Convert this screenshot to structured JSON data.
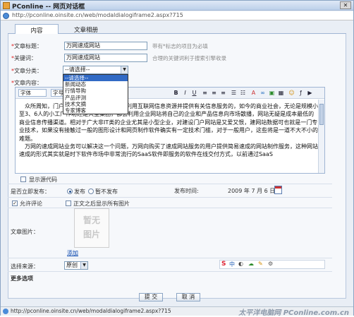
{
  "window": {
    "title": "PConline -- 网页对话框",
    "close": "✕"
  },
  "address": {
    "url": "http://pconline.oinsite.cn/web/modaldialogiframe2.aspx?715"
  },
  "tabs": [
    {
      "label": "内容"
    },
    {
      "label": "文章相册"
    }
  ],
  "form": {
    "title_label": "文章标题：",
    "title_value": "万网速成网站",
    "title_hint": "带有*标志的项目为必填",
    "keyword_label": "关键词：",
    "keyword_value": "万网速成网站",
    "keyword_hint": "合理的关键词利于搜索引擎收录",
    "category_label": "文章分类：",
    "category_value": "--请选择--",
    "content_label": "文章内容："
  },
  "dropdown": {
    "items": [
      "--请选择--",
      "新闻动态",
      "行情导购",
      "产品评测",
      "技术文摘",
      "专家博客"
    ]
  },
  "toolbar": {
    "font_label": "字体",
    "size_label": "字号",
    "bold": "B",
    "italic": "I",
    "underline": "U"
  },
  "content": {
    "p1": "众所周知，门户网站的最大特色是它能够利用互联网信息资源并提供有关信息服务的，如今的商业社会，无论是规模小至3、6人的小工厂作坊还是大型集团，都会利用企业网站将自己的企业和产品信息向市场散播，网站无疑是成本最低的商业信息传播渠道。相对于广大非IT类的企业尤其是小型企业，对建设门户网站是又爱又恨，建网站数据可也就是一门专业技术，如果没有接触过一般的图形设计和网页制作软件确实有一定技术门槛，对于一般用户，这些将是一道不大不小的难题。",
    "p2": "万网的速成网站业务可以解决这一个问题，万网向购买了速成网站服务的用户提供简易速成的网站制作服务，这种网站速成的形式其实就是时下软件市场中非常流行的SaaS软件即服务的软件在线交付方式，以前通过SaaS"
  },
  "source_mode": {
    "label": "显示源代码"
  },
  "publish": {
    "label": "是否立即发布：",
    "opt_yes": "发布",
    "opt_no": "暂不发布",
    "time_label": "发布时间:",
    "date": "2009 年 7 月 6 日"
  },
  "comment": {
    "label": "允许评论",
    "gallery_label": "正文之后显示所有图片"
  },
  "image": {
    "label": "文章图片：",
    "placeholder": "暂无图片",
    "add_link": "添加"
  },
  "source": {
    "label": "选择来源：",
    "value": "原创"
  },
  "more_options": "更多选项",
  "buttons": {
    "submit": "提 交",
    "cancel": "取 消"
  },
  "status": {
    "url": "http://pconline.oinsite.cn/web/modaldialogiframe2.aspx?715"
  },
  "watermark": "太平洋电脑网 PConline.com.cn",
  "colors": {
    "accent": "#316ac5",
    "required": "#d22222",
    "title_bg": "#bcd0ea"
  }
}
